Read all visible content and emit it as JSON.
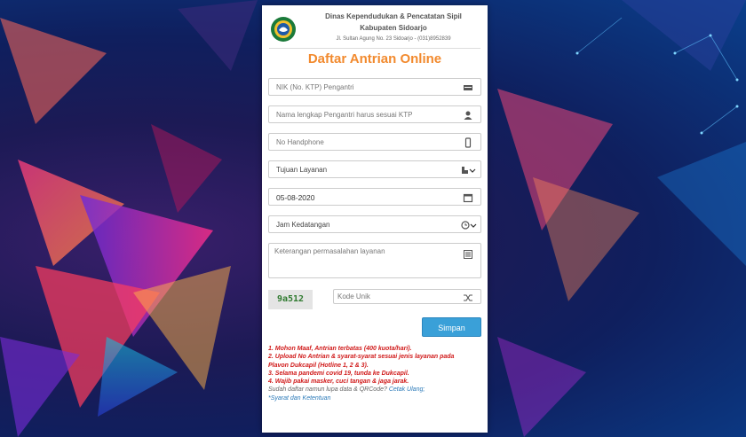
{
  "header": {
    "org_line1": "Dinas Kependudukan & Pencatatan Sipil",
    "org_line2": "Kabupaten Sidoarjo",
    "address": "Jl. Sultan Agung No. 23 Sidoarjo - (031)8952839"
  },
  "form": {
    "title": "Daftar Antrian Online",
    "nik_placeholder": "NIK (No. KTP) Pengantri",
    "name_placeholder": "Nama lengkap Pengantri harus sesuai KTP",
    "phone_placeholder": "No Handphone",
    "service_select": "Tujuan Layanan",
    "date_value": "05-08-2020",
    "time_select": "Jam Kedatangan",
    "notes_placeholder": "Keterangan permasalahan layanan",
    "captcha_text": "9a512",
    "code_placeholder": "Kode Unik",
    "submit_label": "Simpan"
  },
  "notes": {
    "n1": "1. Mohon Maaf, Antrian terbatas (400 kuota/hari).",
    "n2a": "2. Upload No Antrian & syarat-syarat sesuai jenis layanan pada",
    "n2b": "Plavon Dukcapil (Hotline 1, 2 & 3).",
    "n3": "3. Selama pandemi covid 19, tunda ke Dukcapil.",
    "n4": "4. Wajib pakai masker, cuci tangan & jaga jarak.",
    "forgot_prefix": "Sudah daftar namun lupa data & QRCode?",
    "forgot_link": "Cetak Ulang;",
    "terms_link": "*Syarat dan Ketentuan"
  },
  "colors": {
    "accent": "#f28a2e",
    "button": "#3aa0d8",
    "warning": "#d01a1a"
  }
}
